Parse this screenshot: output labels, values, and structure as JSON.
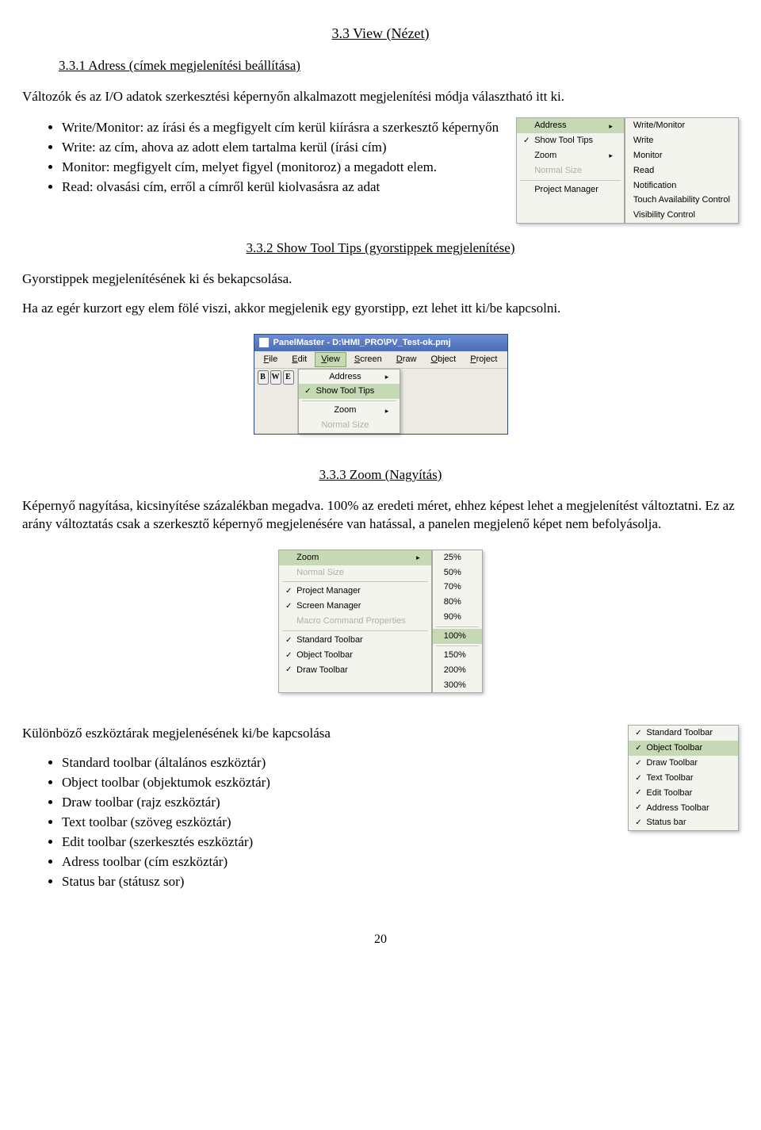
{
  "h_main": "3.3 View (Nézet)",
  "h_sub1": "3.3.1 Adress (címek megjelenítési beállítása)",
  "p_intro1": "Változók és az I/O adatok szerkesztési képernyőn alkalmazott megjelenítési módja választható itt ki.",
  "bul1": [
    "Write/Monitor: az írási és a megfigyelt cím kerül kiírásra a szerkesztő képernyőn",
    "Write: az cím, ahova az adott elem tartalma kerül (írási cím)",
    "Monitor: megfigyelt cím, melyet figyel (monitoroz) a megadott elem.",
    "Read: olvasási cím, erről a címről kerül kiolvasásra az adat"
  ],
  "fig1_menu": [
    {
      "chk": "",
      "lbl": "Address",
      "arr": "▸",
      "dis": false,
      "hi": true
    },
    {
      "chk": "✓",
      "lbl": "Show Tool Tips",
      "arr": "",
      "dis": false
    },
    {
      "chk": "",
      "lbl": "Zoom",
      "arr": "▸",
      "dis": false
    },
    {
      "chk": "",
      "lbl": "Normal Size",
      "arr": "",
      "dis": true
    },
    {
      "chk": "",
      "lbl": "Project Manager",
      "arr": "",
      "dis": false
    }
  ],
  "fig1_sub": [
    "Write/Monitor",
    "Write",
    "Monitor",
    "Read",
    "Notification",
    "Touch Availability Control",
    "Visibility Control"
  ],
  "h_sub2": "3.3.2 Show Tool Tips (gyorstippek megjelenítése)",
  "p_tip1": "Gyorstippek megjelenítésének ki és bekapcsolása.",
  "p_tip2": "Ha az egér kurzort egy elem fölé viszi, akkor megjelenik egy gyorstipp, ezt lehet itt ki/be kapcsolni.",
  "fig2": {
    "title": "PanelMaster - D:\\HMI_PRO\\PV_Test-ok.pmj",
    "menubar": [
      "File",
      "Edit",
      "View",
      "Screen",
      "Draw",
      "Object",
      "Project"
    ],
    "menubar_hi": 2,
    "tbbtns": [
      "B",
      "W",
      "E"
    ],
    "drop": [
      {
        "chk": "",
        "lbl": "Address",
        "arr": "▸",
        "dis": false
      },
      {
        "chk": "✓",
        "lbl": "Show Tool Tips",
        "arr": "",
        "dis": false,
        "hi": true
      },
      {
        "chk": "",
        "lbl": "Zoom",
        "arr": "▸",
        "dis": false
      },
      {
        "chk": "",
        "lbl": "Normal Size",
        "arr": "",
        "dis": true
      }
    ]
  },
  "h_sub3": "3.3.3 Zoom (Nagyítás)",
  "p_zoom": "Képernyő nagyítása, kicsinyítése százalékban megadva. 100% az eredeti méret, ehhez képest lehet a megjelenítést változtatni. Ez az arány változtatás csak a szerkesztő képernyő megjelenésére van hatással, a panelen megjelenő képet nem befolyásolja.",
  "fig3_menu": [
    {
      "chk": "",
      "lbl": "Zoom",
      "arr": "▸",
      "dis": false,
      "hi": true
    },
    {
      "chk": "",
      "lbl": "Normal Size",
      "arr": "",
      "dis": true
    },
    {
      "chk": "✓",
      "lbl": "Project Manager",
      "arr": "",
      "dis": false
    },
    {
      "chk": "✓",
      "lbl": "Screen Manager",
      "arr": "",
      "dis": false
    },
    {
      "chk": "",
      "lbl": "Macro Command Properties",
      "arr": "",
      "dis": true
    },
    {
      "chk": "✓",
      "lbl": "Standard Toolbar",
      "arr": "",
      "dis": false
    },
    {
      "chk": "✓",
      "lbl": "Object Toolbar",
      "arr": "",
      "dis": false
    },
    {
      "chk": "✓",
      "lbl": "Draw Toolbar",
      "arr": "",
      "dis": false
    }
  ],
  "fig3_break_after": [
    1,
    4
  ],
  "fig3_zoom": [
    "25%",
    "50%",
    "70%",
    "80%",
    "90%",
    "100%",
    "150%",
    "200%",
    "300%"
  ],
  "fig3_zoom_hi": 5,
  "fig3_zoom_break_after": [
    4,
    5
  ],
  "p_tool": "Különböző eszköztárak megjelenésének ki/be kapcsolása",
  "bul_tool": [
    "Standard toolbar (általános eszköztár)",
    "Object toolbar (objektumok eszköztár)",
    "Draw toolbar (rajz eszköztár)",
    "Text toolbar (szöveg eszköztár)",
    "Edit toolbar (szerkesztés eszköztár)",
    "Adress toolbar (cím eszköztár)",
    "Status bar (státusz sor)"
  ],
  "fig4_menu": [
    {
      "chk": "✓",
      "lbl": "Standard Toolbar"
    },
    {
      "chk": "✓",
      "lbl": "Object Toolbar",
      "hi": true
    },
    {
      "chk": "✓",
      "lbl": "Draw Toolbar"
    },
    {
      "chk": "✓",
      "lbl": "Text Toolbar"
    },
    {
      "chk": "✓",
      "lbl": "Edit Toolbar"
    },
    {
      "chk": "✓",
      "lbl": "Address Toolbar"
    },
    {
      "chk": "✓",
      "lbl": "Status bar"
    }
  ],
  "page_no": "20"
}
